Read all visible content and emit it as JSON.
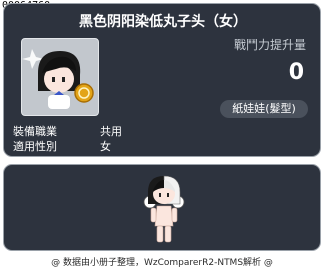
{
  "item_id": "00064760",
  "item": {
    "name": "黑色阴阳染低丸子头（女）",
    "power_label": "戰鬥力提升量",
    "power_value": "0",
    "category": "紙娃娃(髮型)"
  },
  "properties": [
    {
      "label": "裝備職業",
      "value": "共用"
    },
    {
      "label": "適用性別",
      "value": "女"
    }
  ],
  "footer": "@ 数据由小册子整理，WzComparerR2-NTMS解析 @",
  "colors": {
    "panel_bg": "#2d333e",
    "panel_border": "#9aa1a9",
    "badge_bg": "#4a515c"
  }
}
